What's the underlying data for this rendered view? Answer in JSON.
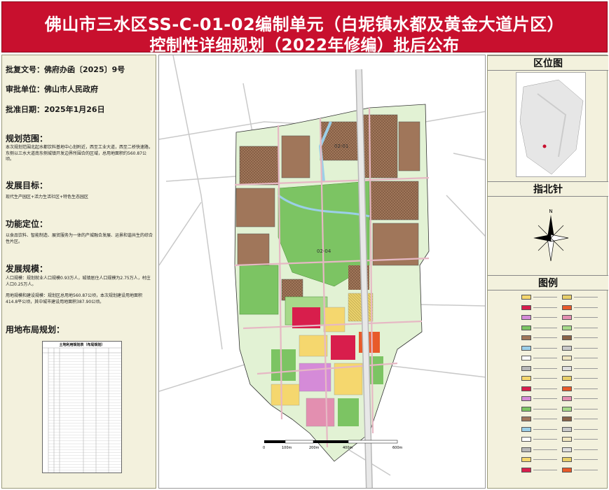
{
  "title": {
    "line1": "佛山市三水区SS-C-01-02编制单元（白坭镇水都及黄金大道片区）",
    "line2": "控制性详细规划（2022年修编）批后公布"
  },
  "meta": {
    "approval_doc": "批复文号：佛府办函〔2025〕9号",
    "approval_unit": "审批单位：佛山市人民政府",
    "approval_date": "批准日期：2025年1月26日"
  },
  "sections": {
    "scope_h": "规划范围：",
    "scope_b": "本次规划范围北起水都饮料基地中心划附近，西至工业大道，西至二桥快速路，东侧以三水大道南东侧城镇开发边界所围合的区域，总用地面积约560.87公顷。",
    "goal_h": "发展目标：",
    "goal_b": "现代生产园区+活力生活社区+特色生态园区",
    "func_h": "功能定位：",
    "func_b": "以食品饮料、智能制造、展贸服务为一体的产城融合发展、运景和谐共生的综合性片区。",
    "scale_h": "发展规模：",
    "scale_b1": "人口规模：规划就业人口规模0.93万人，城镇居住人口规模为2.75万人，村庄人口0.25万人。",
    "scale_b2": "用地规模和建设规模：规划区总用地560.87公顷，本次规划建设用地面积414.8平公顷，其中城市建设用地面积387.90公顷。",
    "layout_h": "用地布局规划："
  },
  "table": {
    "title": "土地利用规划表（布局规划）"
  },
  "map_labels": {
    "unit1": "02-01",
    "unit2": "02-04",
    "scale_0": "0",
    "scale_1": "100m",
    "scale_2": "200m",
    "scale_3": "400m",
    "scale_4": "600m"
  },
  "right": {
    "locator_h": "区位图",
    "north_h": "指北针",
    "north_n": "N",
    "legend_h": "图例"
  },
  "colors": {
    "title_red": "#c8102e",
    "panel": "#f3f1dd",
    "industrial": "#a0765a",
    "green": "#7cc463",
    "residential": "#f5d76e",
    "commercial": "#d81e4c",
    "water": "#9bcfe8"
  },
  "icons": [
    "north-arrow-icon",
    "locator-map-icon"
  ]
}
